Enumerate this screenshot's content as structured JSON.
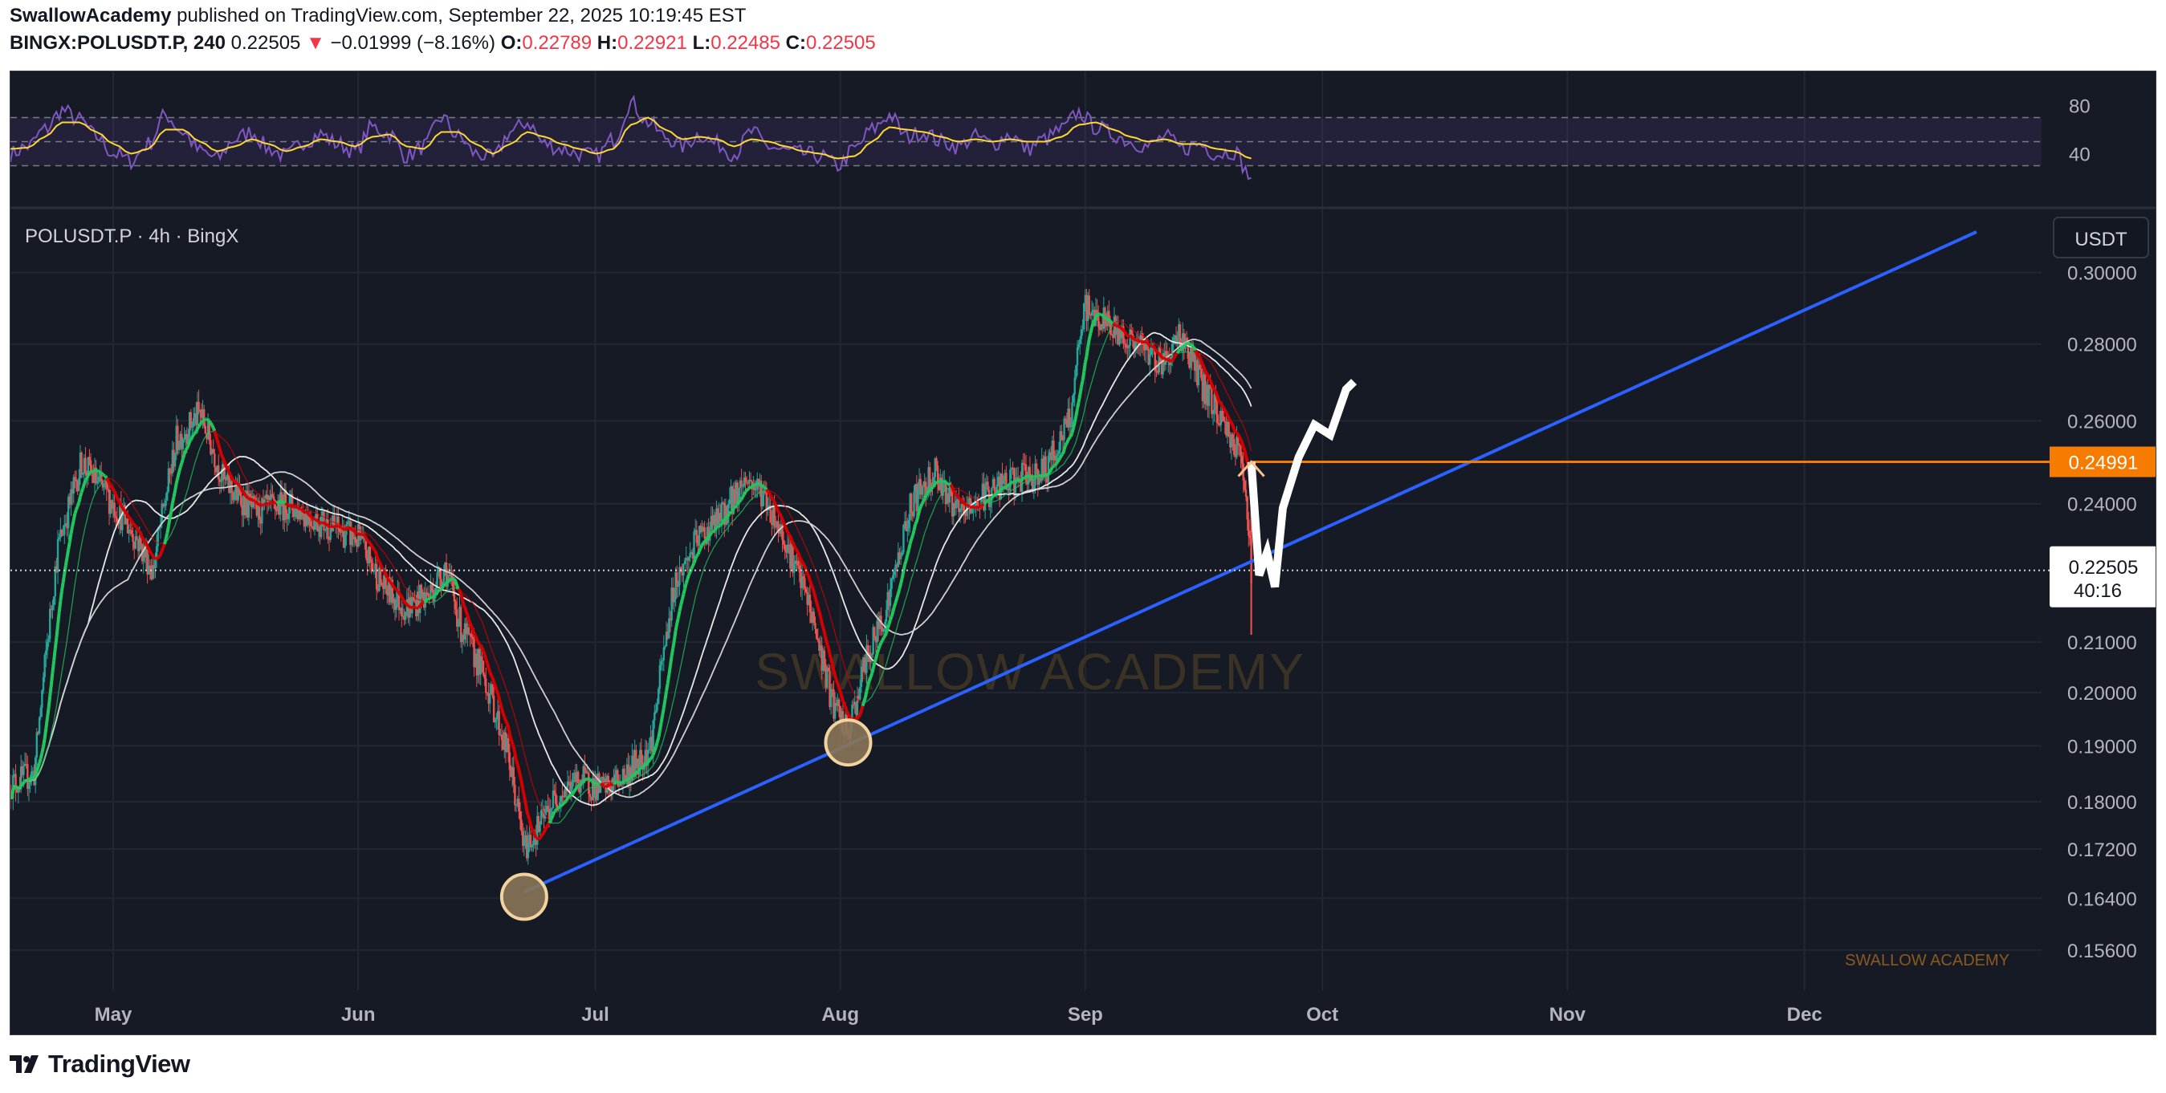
{
  "header": {
    "author": "SwallowAcademy",
    "published_text": "published on TradingView.com, September 22, 2025 10:19:45 EST",
    "symbol": "BINGX:POLUSDT.P, 240",
    "last": "0.22505",
    "change_arrow": "▼",
    "change": "−0.01999 (−8.16%)",
    "o_label": "O:",
    "o_value": "0.22789",
    "h_label": "H:",
    "h_value": "0.22921",
    "l_label": "L:",
    "l_value": "0.22485",
    "c_label": "C:",
    "c_value": "0.22505"
  },
  "pane_label": "POLUSDT.P · 4h · BingX",
  "currency_button": "USDT",
  "watermark": "SWALLOW ACADEMY",
  "corner_watermark": "SWALLOW ACADEMY",
  "price_label": {
    "value": "0.22505",
    "countdown": "40:16"
  },
  "level_label": "0.24991",
  "footer": {
    "brand": "TradingView"
  },
  "colors": {
    "background": "#161a25",
    "grid": "#232733",
    "text": "#b2b5be",
    "trendline": "#2962ff",
    "level": "#f57c00",
    "up": "#26a69a",
    "down": "#ef5350",
    "rsi": "#7e57c2",
    "rsi_ma": "#fdd835",
    "ribbon_up": "#22c55e",
    "ribbon_down": "#d50000",
    "projection": "#ffffff",
    "circle": "#f2d3a0"
  },
  "chart_data": [
    {
      "type": "line",
      "name": "RSI",
      "y_ticks": [
        "80",
        "40"
      ],
      "ylim": [
        15,
        95
      ],
      "levels": [
        70,
        50,
        30
      ],
      "series": [
        {
          "values": [
            40,
            46,
            60,
            76,
            68,
            54,
            40,
            34,
            48,
            72,
            58,
            42,
            36,
            52,
            58,
            44,
            38,
            50,
            56,
            48,
            42,
            62,
            56,
            38,
            46,
            70,
            54,
            40,
            36,
            58,
            66,
            48,
            44,
            40,
            38,
            52,
            82,
            66,
            54,
            46,
            56,
            48,
            40,
            58,
            46,
            42,
            40,
            38,
            30,
            44,
            60,
            72,
            54,
            58,
            50,
            46,
            54,
            48,
            56,
            44,
            52,
            60,
            74,
            62,
            56,
            50,
            46,
            54,
            44,
            48,
            40,
            42,
            20
          ]
        },
        {
          "values": [
            44,
            45,
            54,
            66,
            66,
            58,
            48,
            40,
            44,
            60,
            60,
            50,
            42,
            46,
            52,
            48,
            42,
            46,
            52,
            50,
            46,
            54,
            56,
            46,
            44,
            58,
            58,
            48,
            40,
            48,
            58,
            54,
            48,
            44,
            40,
            44,
            64,
            70,
            60,
            52,
            54,
            52,
            46,
            52,
            50,
            46,
            42,
            40,
            36,
            38,
            50,
            62,
            60,
            58,
            54,
            50,
            52,
            50,
            52,
            50,
            50,
            54,
            64,
            66,
            60,
            54,
            50,
            52,
            48,
            48,
            44,
            42,
            36
          ]
        }
      ]
    },
    {
      "type": "candlestick",
      "title": "POLUSDT.P · 4h · BingX",
      "scale": "log",
      "ylim": [
        0.153,
        0.312
      ],
      "y_ticks": [
        "0.30000",
        "0.28000",
        "0.26000",
        "0.24000",
        "0.21000",
        "0.20000",
        "0.19000",
        "0.18000",
        "0.17200",
        "0.16400",
        "0.15600"
      ],
      "x_ticks": [
        "May",
        "Jun",
        "Jul",
        "Aug",
        "Sep",
        "Oct",
        "Nov",
        "Dec"
      ],
      "x_range": [
        "2025-04-18",
        "2025-12-31"
      ],
      "x_tick_dates": [
        "2025-05-01",
        "2025-06-01",
        "2025-07-01",
        "2025-08-01",
        "2025-09-01",
        "2025-10-01",
        "2025-11-01",
        "2025-12-01"
      ],
      "price_path": [
        [
          "2025-04-18",
          0.183
        ],
        [
          "2025-04-21",
          0.185
        ],
        [
          "2025-04-24",
          0.23
        ],
        [
          "2025-04-27",
          0.25
        ],
        [
          "2025-05-01",
          0.24
        ],
        [
          "2025-05-04",
          0.232
        ],
        [
          "2025-05-06",
          0.225
        ],
        [
          "2025-05-09",
          0.255
        ],
        [
          "2025-05-12",
          0.262
        ],
        [
          "2025-05-15",
          0.245
        ],
        [
          "2025-05-19",
          0.238
        ],
        [
          "2025-05-23",
          0.24
        ],
        [
          "2025-05-27",
          0.236
        ],
        [
          "2025-06-01",
          0.232
        ],
        [
          "2025-06-04",
          0.222
        ],
        [
          "2025-06-07",
          0.217
        ],
        [
          "2025-06-10",
          0.22
        ],
        [
          "2025-06-12",
          0.226
        ],
        [
          "2025-06-14",
          0.213
        ],
        [
          "2025-06-17",
          0.203
        ],
        [
          "2025-06-20",
          0.188
        ],
        [
          "2025-06-22",
          0.172
        ],
        [
          "2025-06-24",
          0.176
        ],
        [
          "2025-06-26",
          0.181
        ],
        [
          "2025-06-29",
          0.184
        ],
        [
          "2025-07-02",
          0.182
        ],
        [
          "2025-07-05",
          0.185
        ],
        [
          "2025-07-08",
          0.19
        ],
        [
          "2025-07-11",
          0.222
        ],
        [
          "2025-07-14",
          0.232
        ],
        [
          "2025-07-17",
          0.237
        ],
        [
          "2025-07-20",
          0.246
        ],
        [
          "2025-07-22",
          0.243
        ],
        [
          "2025-07-25",
          0.232
        ],
        [
          "2025-07-28",
          0.218
        ],
        [
          "2025-07-31",
          0.198
        ],
        [
          "2025-08-02",
          0.192
        ],
        [
          "2025-08-04",
          0.205
        ],
        [
          "2025-08-07",
          0.218
        ],
        [
          "2025-08-10",
          0.24
        ],
        [
          "2025-08-13",
          0.248
        ],
        [
          "2025-08-16",
          0.237
        ],
        [
          "2025-08-20",
          0.243
        ],
        [
          "2025-08-24",
          0.246
        ],
        [
          "2025-08-27",
          0.248
        ],
        [
          "2025-08-30",
          0.26
        ],
        [
          "2025-09-01",
          0.29
        ],
        [
          "2025-09-04",
          0.285
        ],
        [
          "2025-09-08",
          0.279
        ],
        [
          "2025-09-11",
          0.275
        ],
        [
          "2025-09-13",
          0.283
        ],
        [
          "2025-09-16",
          0.268
        ],
        [
          "2025-09-19",
          0.258
        ],
        [
          "2025-09-21",
          0.249
        ],
        [
          "2025-09-22",
          0.225
        ]
      ],
      "projection": [
        [
          "2025-09-22",
          0.2499
        ],
        [
          "2025-09-23",
          0.224
        ],
        [
          "2025-09-24",
          0.229
        ],
        [
          "2025-09-25",
          0.2215
        ],
        [
          "2025-09-26",
          0.239
        ],
        [
          "2025-09-28",
          0.251
        ],
        [
          "2025-09-30",
          0.259
        ],
        [
          "2025-10-02",
          0.2565
        ],
        [
          "2025-10-04",
          0.268
        ],
        [
          "2025-10-05",
          0.27
        ]
      ],
      "trendline": [
        [
          "2025-06-22",
          0.165
        ],
        [
          "2025-08-02",
          0.1915
        ],
        [
          "2025-09-21",
          0.2262
        ]
      ],
      "horizontal_level": 0.24991,
      "last_price": 0.22505,
      "touch_points": [
        [
          "2025-06-22",
          0.165
        ],
        [
          "2025-08-02",
          0.1915
        ]
      ]
    }
  ]
}
